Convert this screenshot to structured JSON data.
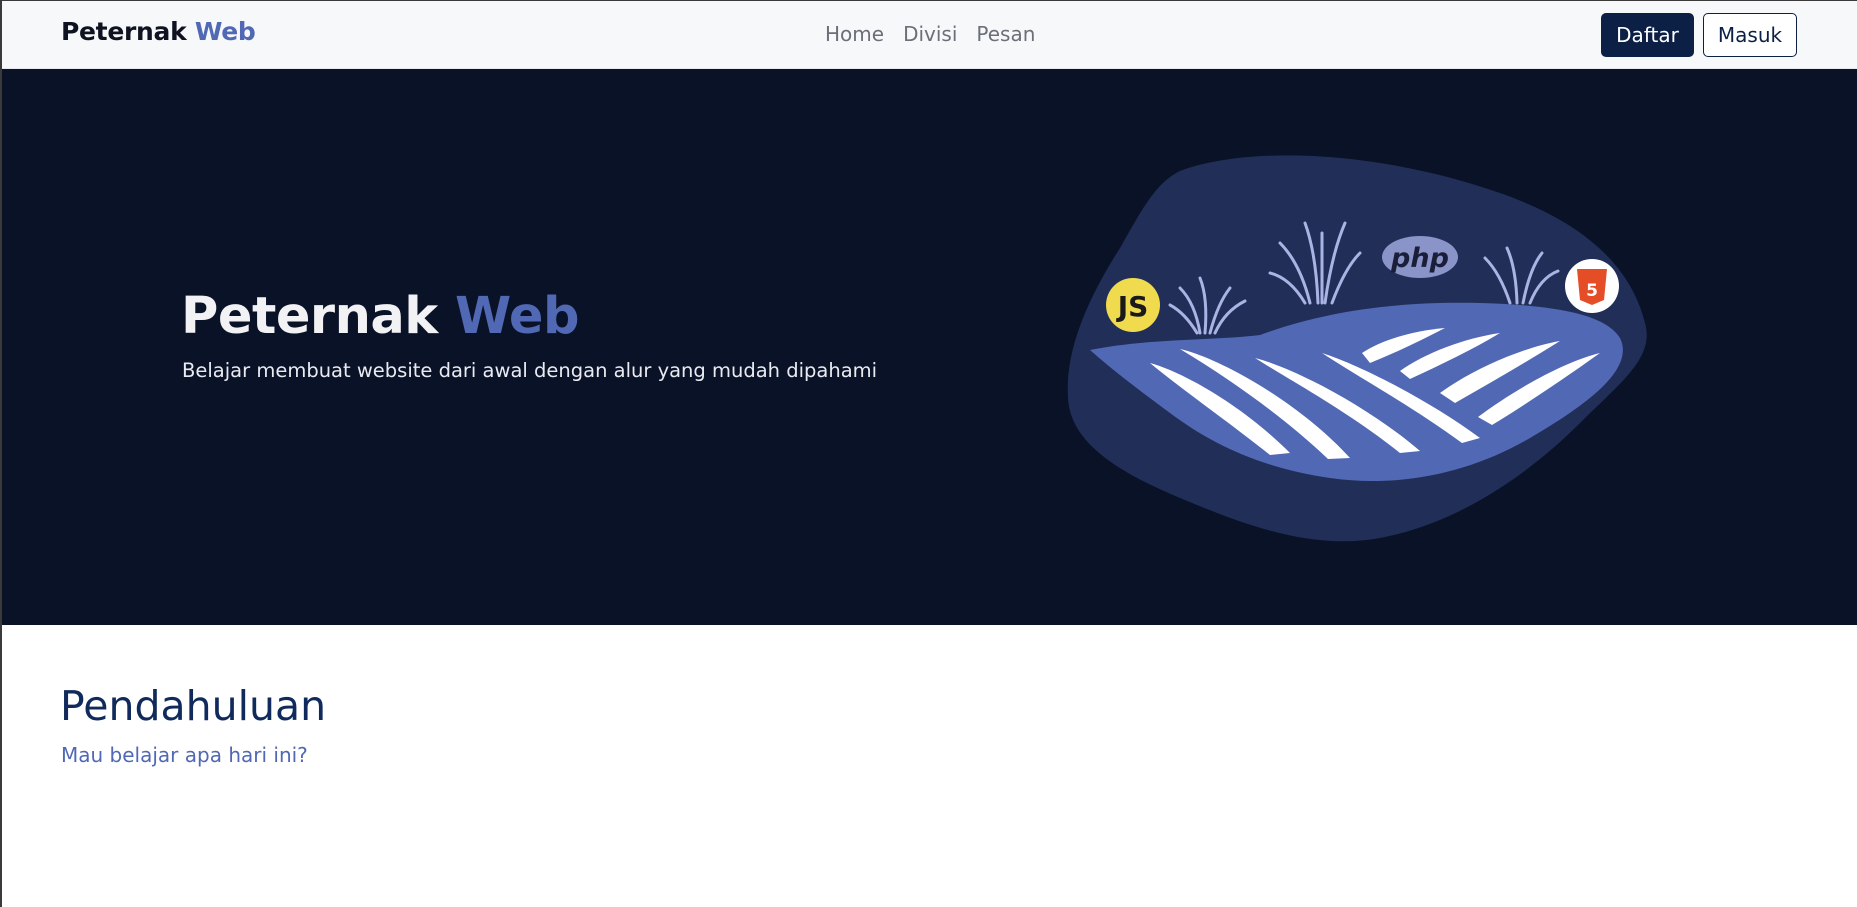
{
  "navbar": {
    "brand_main": "Peternak",
    "brand_accent": "Web",
    "links": [
      {
        "label": "Home"
      },
      {
        "label": "Divisi"
      },
      {
        "label": "Pesan"
      }
    ],
    "register_label": "Daftar",
    "login_label": "Masuk"
  },
  "hero": {
    "title_main": "Peternak",
    "title_accent": "Web",
    "subtitle": "Belajar membuat website dari awal dengan alur yang mudah dipahami",
    "badges": {
      "js": "JS",
      "php": "php",
      "html5": "5"
    }
  },
  "intro": {
    "title": "Pendahuluan",
    "subtitle": "Mau belajar apa hari ini?"
  },
  "colors": {
    "accent": "#5168b5",
    "dark_navy": "#0a1227",
    "button_navy": "#0c1f45",
    "blob": "#212e57",
    "field": "#5168b5",
    "js_yellow": "#f0db4f",
    "html_orange": "#e44d26",
    "php_badge": "#8a94c8"
  },
  "icons": [
    "js-logo-icon",
    "php-logo-icon",
    "html5-logo-icon"
  ]
}
